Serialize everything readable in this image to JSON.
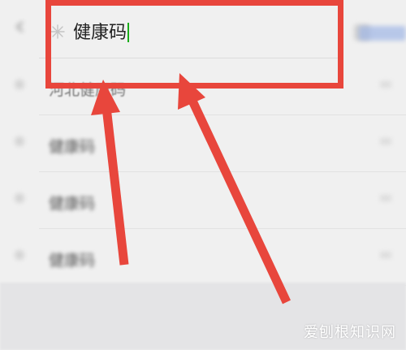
{
  "search": {
    "value": "健康码",
    "button_label": "搜索"
  },
  "suggestions": [
    {
      "text": "河北健康码"
    },
    {
      "text": "健康码"
    },
    {
      "text": "健康码"
    },
    {
      "text": "健康码"
    }
  ],
  "watermark": "爱刨根知识网",
  "colors": {
    "highlight": "#e8463c",
    "caret": "#1aad19",
    "background": "#f0f0f0"
  },
  "icons": {
    "back": "back-arrow-icon",
    "search_prefix": "star-icon",
    "voice": "voice-icon"
  }
}
